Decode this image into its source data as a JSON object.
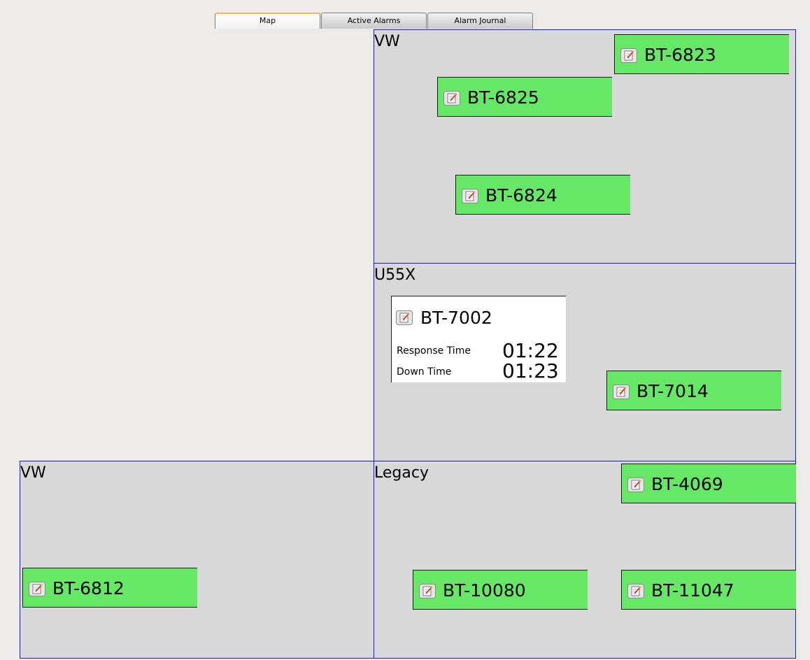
{
  "tabs": [
    {
      "label": "Map",
      "active": true
    },
    {
      "label": "Active Alarms",
      "active": false
    },
    {
      "label": "Alarm Journal",
      "active": false
    }
  ],
  "colors": {
    "background": "#ecebe7",
    "zone_fill": "#d8d8d8",
    "zone_border": "#1a1ad6",
    "device_ok": "#66e866",
    "active_tab_accent": "#f0b45a"
  },
  "zones": [
    {
      "label": "VW",
      "devices": [
        {
          "label": "BT-6823",
          "icon": "edit-icon",
          "status_color": "#66e866"
        },
        {
          "label": "BT-6825",
          "icon": "edit-icon",
          "status_color": "#66e866"
        },
        {
          "label": "BT-6824",
          "icon": "edit-icon",
          "status_color": "#66e866"
        }
      ]
    },
    {
      "label": "U55X",
      "alarm_card": {
        "label": "BT-7002",
        "icon": "edit-icon",
        "response_time_label": "Response Time",
        "response_time_value": "01:22",
        "down_time_label": "Down Time",
        "down_time_value": "01:23"
      },
      "devices": [
        {
          "label": "BT-7014",
          "icon": "edit-icon",
          "status_color": "#66e866"
        }
      ]
    },
    {
      "label": "VW",
      "devices": [
        {
          "label": "BT-6812",
          "icon": "edit-icon",
          "status_color": "#66e866"
        }
      ]
    },
    {
      "label": "Legacy",
      "devices": [
        {
          "label": "BT-4069",
          "icon": "edit-icon",
          "status_color": "#66e866"
        },
        {
          "label": "BT-10080",
          "icon": "edit-icon",
          "status_color": "#66e866"
        },
        {
          "label": "BT-11047",
          "icon": "edit-icon",
          "status_color": "#66e866"
        }
      ]
    }
  ]
}
